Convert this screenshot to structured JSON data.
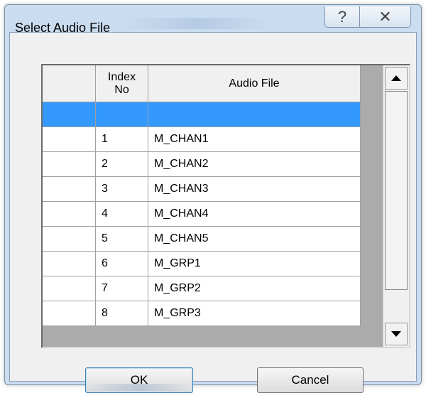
{
  "window": {
    "title": "Select Audio File",
    "help_symbol": "?",
    "close_symbol": "✕"
  },
  "grid": {
    "columns": [
      "",
      "Index\nNo",
      "Audio File"
    ],
    "rows": [
      {
        "index": "",
        "file": "",
        "selected": true
      },
      {
        "index": "1",
        "file": "M_CHAN1"
      },
      {
        "index": "2",
        "file": "M_CHAN2"
      },
      {
        "index": "3",
        "file": "M_CHAN3"
      },
      {
        "index": "4",
        "file": "M_CHAN4"
      },
      {
        "index": "5",
        "file": "M_CHAN5"
      },
      {
        "index": "6",
        "file": "M_GRP1"
      },
      {
        "index": "7",
        "file": "M_GRP2"
      },
      {
        "index": "8",
        "file": "M_GRP3"
      }
    ]
  },
  "buttons": {
    "ok": "OK",
    "cancel": "Cancel"
  }
}
